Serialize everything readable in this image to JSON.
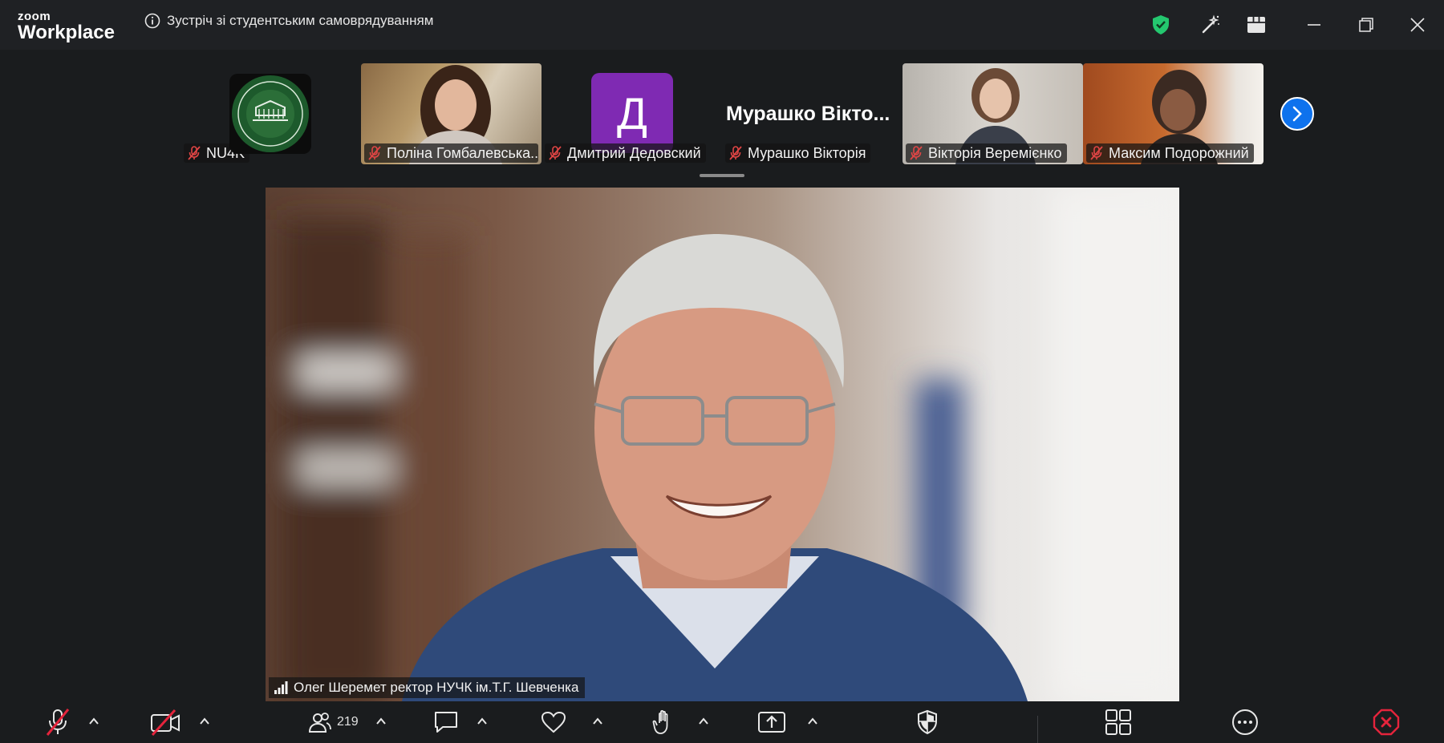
{
  "app": {
    "brand_top": "zoom",
    "brand_bottom": "Workplace",
    "meeting_title": "Зустріч зі студентським самоврядуванням"
  },
  "title_icons": [
    "shield-check-icon",
    "magic-wand-icon",
    "view-grid-icon",
    "minimize-icon",
    "restore-icon",
    "close-icon"
  ],
  "participants": [
    {
      "name": "NU4K",
      "muted": true,
      "type": "logo"
    },
    {
      "name": "Поліна Гомбалевська...",
      "muted": true,
      "type": "video"
    },
    {
      "name": "Дмитрий Дедовский",
      "muted": true,
      "type": "avatar",
      "initial": "Д",
      "avatar_color": "#7f2ab3"
    },
    {
      "name": "Мурашко Вікторія",
      "muted": true,
      "type": "name",
      "display_name": "Мурашко  Вікто..."
    },
    {
      "name": "Вікторія Веремієнко",
      "muted": true,
      "type": "video"
    },
    {
      "name": "Максим Подорожний",
      "muted": true,
      "type": "video"
    }
  ],
  "active_speaker": {
    "name": "Олег Шеремет ректор НУЧК ім.Т.Г. Шевченка"
  },
  "toolbar": {
    "participants_count": "219",
    "buttons": [
      "unmute",
      "start-video",
      "participants",
      "chat",
      "react",
      "raise-hand",
      "share",
      "security",
      "apps",
      "more",
      "leave"
    ]
  },
  "colors": {
    "accent": "#0e72ed",
    "shield": "#24c76f",
    "leave": "#e5243c",
    "muted_red": "#e04545"
  }
}
